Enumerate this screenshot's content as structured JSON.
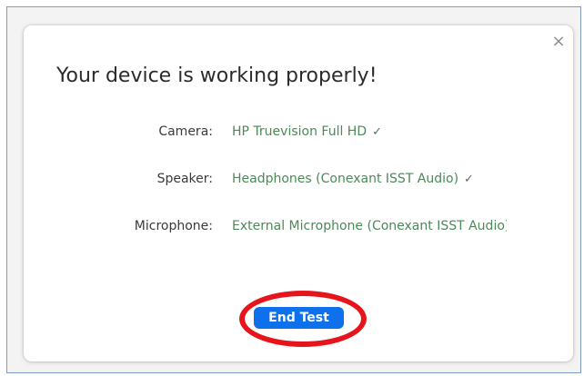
{
  "dialog": {
    "close_symbol": "×",
    "title": "Your device is working properly!",
    "rows": [
      {
        "label": "Camera:",
        "value": "HP Truevision Full HD",
        "check": "✓"
      },
      {
        "label": "Speaker:",
        "value": "Headphones (Conexant ISST Audio)",
        "check": "✓"
      },
      {
        "label": "Microphone:",
        "value": "External Microphone (Conexant ISST Audio)"
      }
    ],
    "end_button_label": "End Test"
  },
  "colors": {
    "accent": "#0e71eb",
    "device_text": "#4a8a56",
    "highlight": "#e8141b",
    "frame_border": "#7f9cc6"
  },
  "icons": {
    "close": "close-icon",
    "check": "checkmark-icon"
  }
}
